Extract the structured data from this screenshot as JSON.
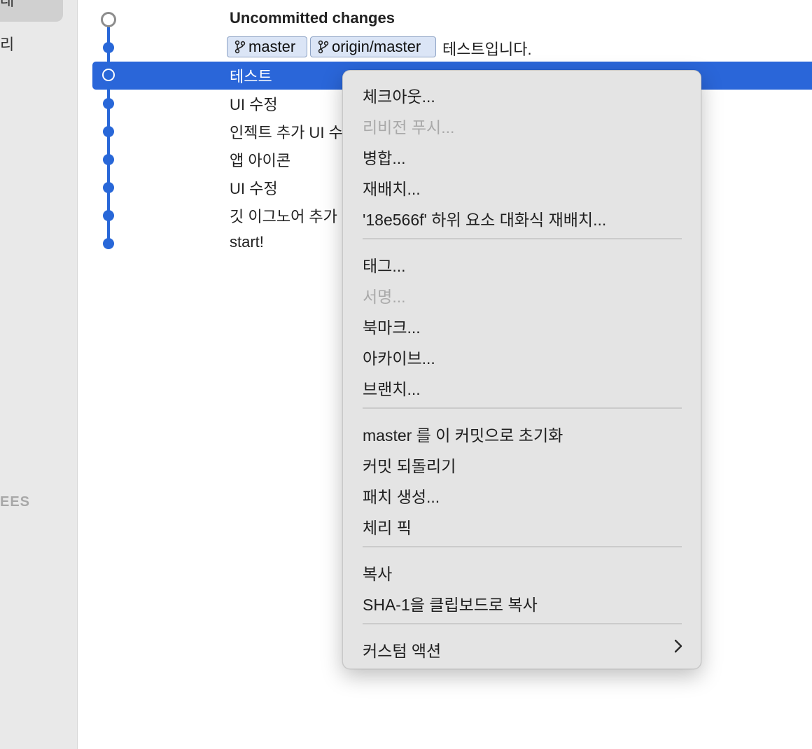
{
  "sidebar": {
    "item_selected_partial": "태",
    "item_partial": "리",
    "section_partial": "EES"
  },
  "commits": [
    {
      "message": "Uncommitted changes"
    },
    {
      "message": "테스트입니다.",
      "branches": [
        "master",
        "origin/master"
      ]
    },
    {
      "message": "테스트"
    },
    {
      "message": "UI 수정"
    },
    {
      "message": "인젝트 추가 UI 수"
    },
    {
      "message": "앱 아이콘"
    },
    {
      "message": "UI 수정"
    },
    {
      "message": "깃 이그노어 추가"
    },
    {
      "message": "start!"
    }
  ],
  "context_menu": {
    "items": [
      {
        "label": "체크아웃...",
        "enabled": true
      },
      {
        "label": "리비전 푸시...",
        "enabled": false
      },
      {
        "label": "병합...",
        "enabled": true
      },
      {
        "label": "재배치...",
        "enabled": true
      },
      {
        "label": "'18e566f' 하위 요소 대화식 재배치...",
        "enabled": true
      },
      {
        "label": "태그...",
        "enabled": true
      },
      {
        "label": "서명...",
        "enabled": false
      },
      {
        "label": "북마크...",
        "enabled": true
      },
      {
        "label": "아카이브...",
        "enabled": true
      },
      {
        "label": "브랜치...",
        "enabled": true
      },
      {
        "label": "master 를 이 커밋으로 초기화",
        "enabled": true
      },
      {
        "label": "커밋 되돌리기",
        "enabled": true
      },
      {
        "label": "패치 생성...",
        "enabled": true
      },
      {
        "label": "체리 픽",
        "enabled": true
      },
      {
        "label": "복사",
        "enabled": true
      },
      {
        "label": "SHA-1을 클립보드로 복사",
        "enabled": true
      },
      {
        "label": "커스텀 액션",
        "enabled": true,
        "submenu": true
      }
    ]
  },
  "colors": {
    "accent": "#2a66d9",
    "graph": "#2867d8",
    "badge_bg": "#dbe5f6",
    "menu_bg": "#e4e4e4"
  },
  "icons": {
    "branch": "branch-icon",
    "submenu": "chevron-right-icon"
  }
}
